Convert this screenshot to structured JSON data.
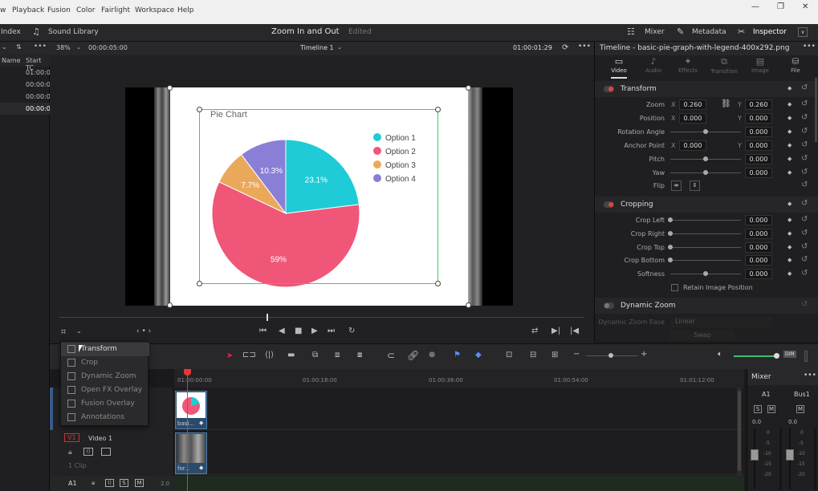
{
  "menubar": {
    "items": [
      "w",
      "Playback",
      "Fusion",
      "Color",
      "Fairlight",
      "Workspace",
      "Help"
    ],
    "window_buttons": [
      "—",
      "❐",
      "✕"
    ]
  },
  "toolbar": {
    "index": "Index",
    "sound_library": "Sound Library",
    "project_title": "Zoom In and Out",
    "edited": "Edited",
    "mixer": "Mixer",
    "metadata": "Metadata",
    "inspector": "Inspector"
  },
  "left_panel": {
    "headers": [
      "Name",
      "Start TC"
    ],
    "rows": [
      "01:00:0",
      "00:00:0",
      "00:00:0",
      "00:00:0"
    ]
  },
  "viewer": {
    "zoom": "38%",
    "timecode_left": "00:00:05:00",
    "timeline_name": "Timeline 1",
    "timecode_right": "01:00:01:29"
  },
  "chart_data": {
    "type": "pie",
    "title": "Pie Chart",
    "slices": [
      {
        "label": "Option 1",
        "value": 23.1,
        "display": "23.1%",
        "color": "#1ecbd6"
      },
      {
        "label": "Option 2",
        "value": 59,
        "display": "59%",
        "color": "#f05677"
      },
      {
        "label": "Option 3",
        "value": 7.7,
        "display": "7.7%",
        "color": "#eaa95a"
      },
      {
        "label": "Option 4",
        "value": 10.3,
        "display": "10.3%",
        "color": "#8a7fd6"
      }
    ],
    "legend_position": "right"
  },
  "inspector": {
    "title": "Timeline - basic-pie-graph-with-legend-400x292.png",
    "tabs": [
      "Video",
      "Audio",
      "Effects",
      "Transition",
      "Image",
      "File"
    ],
    "transform": {
      "title": "Transform",
      "zoom_label": "Zoom",
      "zoom_x": "0.260",
      "zoom_y": "0.260",
      "position_label": "Position",
      "position_x": "0.000",
      "position_y": "0.000",
      "rotation_label": "Rotation Angle",
      "rotation": "0.000",
      "anchor_label": "Anchor Point",
      "anchor_x": "0.000",
      "anchor_y": "0.000",
      "pitch_label": "Pitch",
      "pitch": "0.000",
      "yaw_label": "Yaw",
      "yaw": "0.000",
      "flip_label": "Flip"
    },
    "cropping": {
      "title": "Cropping",
      "left_label": "Crop Left",
      "left": "0.000",
      "right_label": "Crop Right",
      "right": "0.000",
      "top_label": "Crop Top",
      "top": "0.000",
      "bottom_label": "Crop Bottom",
      "bottom": "0.000",
      "softness_label": "Softness",
      "softness": "0.000",
      "retain_label": "Retain Image Position"
    },
    "dynamic_zoom": {
      "title": "Dynamic Zoom",
      "ease_label": "Dynamic Zoom Ease",
      "ease_value": "Linear",
      "swap": "Swap"
    },
    "axis_x": "X",
    "axis_y": "Y"
  },
  "overlay_menu": {
    "items": [
      "Transform",
      "Crop",
      "Dynamic Zoom",
      "Open FX Overlay",
      "Fusion Overlay",
      "Annotations"
    ]
  },
  "timeline": {
    "ruler": [
      "01:00:00:00",
      "01:00:18:00",
      "01:00:36:00",
      "01:00:54:00",
      "01:01:12:00"
    ],
    "clip1_name": "basi...",
    "clip2_name": "for...",
    "video_track_id": "V1",
    "video_track_name": "Video 1",
    "clip_count": "1 Clip",
    "audio_track_id": "A1",
    "audio_level": "2.0",
    "solo": "S",
    "mute": "M",
    "dim": "DIM"
  },
  "mixer_panel": {
    "title": "Mixer",
    "ch1": "A1",
    "ch2": "Bus1",
    "val1": "0.0",
    "val2": "0.0",
    "scale": [
      "0",
      "-5",
      "-10",
      "-15",
      "-20"
    ]
  }
}
